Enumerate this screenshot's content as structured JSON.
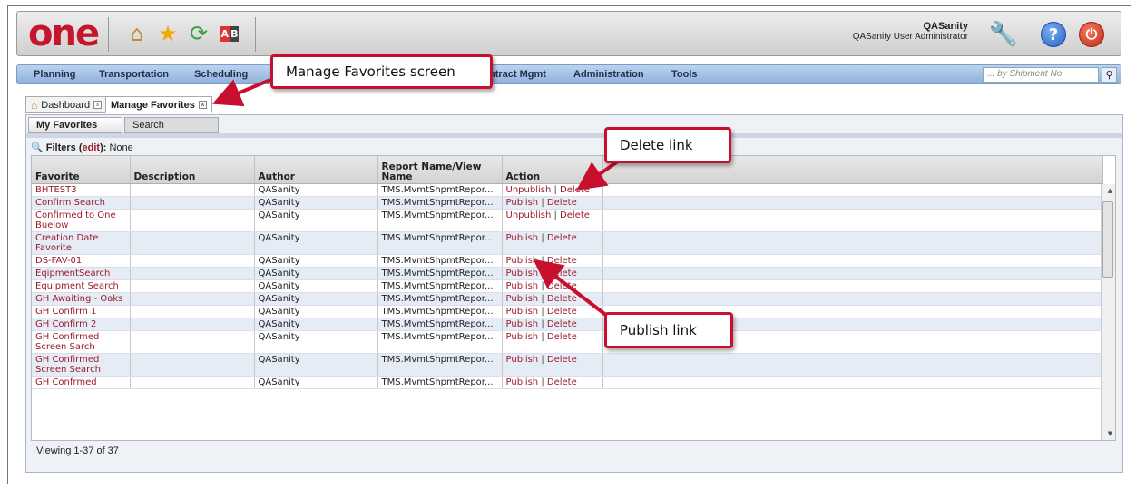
{
  "header": {
    "logo": "one",
    "icons": [
      "home-icon",
      "star-icon",
      "refresh-icon",
      "ab-icon"
    ],
    "user_name": "QASanity",
    "user_role": "QASanity User Administrator"
  },
  "menu": {
    "items": [
      "Planning",
      "Transportation",
      "Scheduling",
      "ntract Mgmt",
      "Administration",
      "Tools"
    ],
    "search_placeholder": "... by Shipment No"
  },
  "page_tabs": [
    {
      "label": "Dashboard",
      "active": false
    },
    {
      "label": "Manage Favorites",
      "active": true
    }
  ],
  "sub_tabs": [
    {
      "label": "My Favorites",
      "active": true
    },
    {
      "label": "Search",
      "active": false
    }
  ],
  "filters": {
    "label": "Filters",
    "edit": "edit",
    "value": "None"
  },
  "table": {
    "columns": [
      "Favorite",
      "Description",
      "Author",
      "Report Name/View Name",
      "Action"
    ],
    "rows": [
      {
        "favorite": "BHTEST3",
        "description": "",
        "author": "QASanity",
        "report": "TMS.MvmtShpmtRepor...",
        "action1": "Unpublish",
        "action2": "Delete"
      },
      {
        "favorite": "Confirm Search",
        "description": "",
        "author": "QASanity",
        "report": "TMS.MvmtShpmtRepor...",
        "action1": "Publish",
        "action2": "Delete"
      },
      {
        "favorite": "Confirmed to One Buelow",
        "description": "",
        "author": "QASanity",
        "report": "TMS.MvmtShpmtRepor...",
        "action1": "Unpublish",
        "action2": "Delete"
      },
      {
        "favorite": "Creation Date Favorite",
        "description": "",
        "author": "QASanity",
        "report": "TMS.MvmtShpmtRepor...",
        "action1": "Publish",
        "action2": "Delete"
      },
      {
        "favorite": "DS-FAV-01",
        "description": "",
        "author": "QASanity",
        "report": "TMS.MvmtShpmtRepor...",
        "action1": "Publish",
        "action2": "Delete"
      },
      {
        "favorite": "EqipmentSearch",
        "description": "",
        "author": "QASanity",
        "report": "TMS.MvmtShpmtRepor...",
        "action1": "Publish",
        "action2": "Delete"
      },
      {
        "favorite": "Equipment Search",
        "description": "",
        "author": "QASanity",
        "report": "TMS.MvmtShpmtRepor...",
        "action1": "Publish",
        "action2": "Delete"
      },
      {
        "favorite": "GH Awaiting - Oaks",
        "description": "",
        "author": "QASanity",
        "report": "TMS.MvmtShpmtRepor...",
        "action1": "Publish",
        "action2": "Delete"
      },
      {
        "favorite": "GH Confirm 1",
        "description": "",
        "author": "QASanity",
        "report": "TMS.MvmtShpmtRepor...",
        "action1": "Publish",
        "action2": "Delete"
      },
      {
        "favorite": "GH Confirm 2",
        "description": "",
        "author": "QASanity",
        "report": "TMS.MvmtShpmtRepor...",
        "action1": "Publish",
        "action2": "Delete"
      },
      {
        "favorite": "GH Confirmed Screen Sarch",
        "description": "",
        "author": "QASanity",
        "report": "TMS.MvmtShpmtRepor...",
        "action1": "Publish",
        "action2": "Delete"
      },
      {
        "favorite": "GH Confirmed Screen Search",
        "description": "",
        "author": "QASanity",
        "report": "TMS.MvmtShpmtRepor...",
        "action1": "Publish",
        "action2": "Delete"
      },
      {
        "favorite": "GH Confrmed",
        "description": "",
        "author": "QASanity",
        "report": "TMS.MvmtShpmtRepor...",
        "action1": "Publish",
        "action2": "Delete"
      }
    ]
  },
  "footer": {
    "viewing": "Viewing 1-37 of 37"
  },
  "callouts": {
    "manage_favorites": "Manage Favorites screen",
    "delete_link": "Delete link",
    "publish_link": "Publish link"
  },
  "colors": {
    "logo": "#c5162e",
    "link": "#9c1b2a",
    "callout_border": "#c8102e",
    "menubar": "#a6c2e6"
  }
}
